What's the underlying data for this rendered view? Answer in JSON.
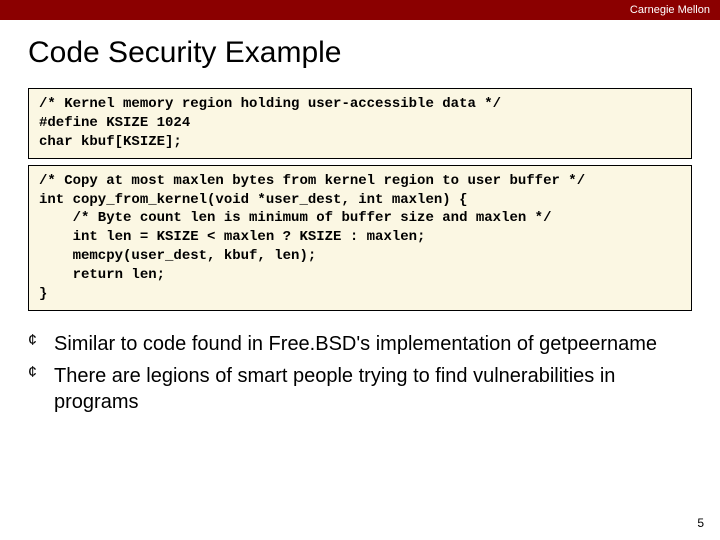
{
  "header": {
    "institution": "Carnegie Mellon"
  },
  "title": "Code Security Example",
  "code_blocks": {
    "block1": "/* Kernel memory region holding user-accessible data */\n#define KSIZE 1024\nchar kbuf[KSIZE];",
    "block2": "/* Copy at most maxlen bytes from kernel region to user buffer */\nint copy_from_kernel(void *user_dest, int maxlen) {\n    /* Byte count len is minimum of buffer size and maxlen */\n    int len = KSIZE < maxlen ? KSIZE : maxlen;\n    memcpy(user_dest, kbuf, len);\n    return len;\n}"
  },
  "bullets": [
    "Similar to code found in Free.BSD's implementation of getpeername",
    "There are legions of smart people trying to find vulnerabilities in programs"
  ],
  "page_number": "5",
  "bullet_glyph": "¢"
}
